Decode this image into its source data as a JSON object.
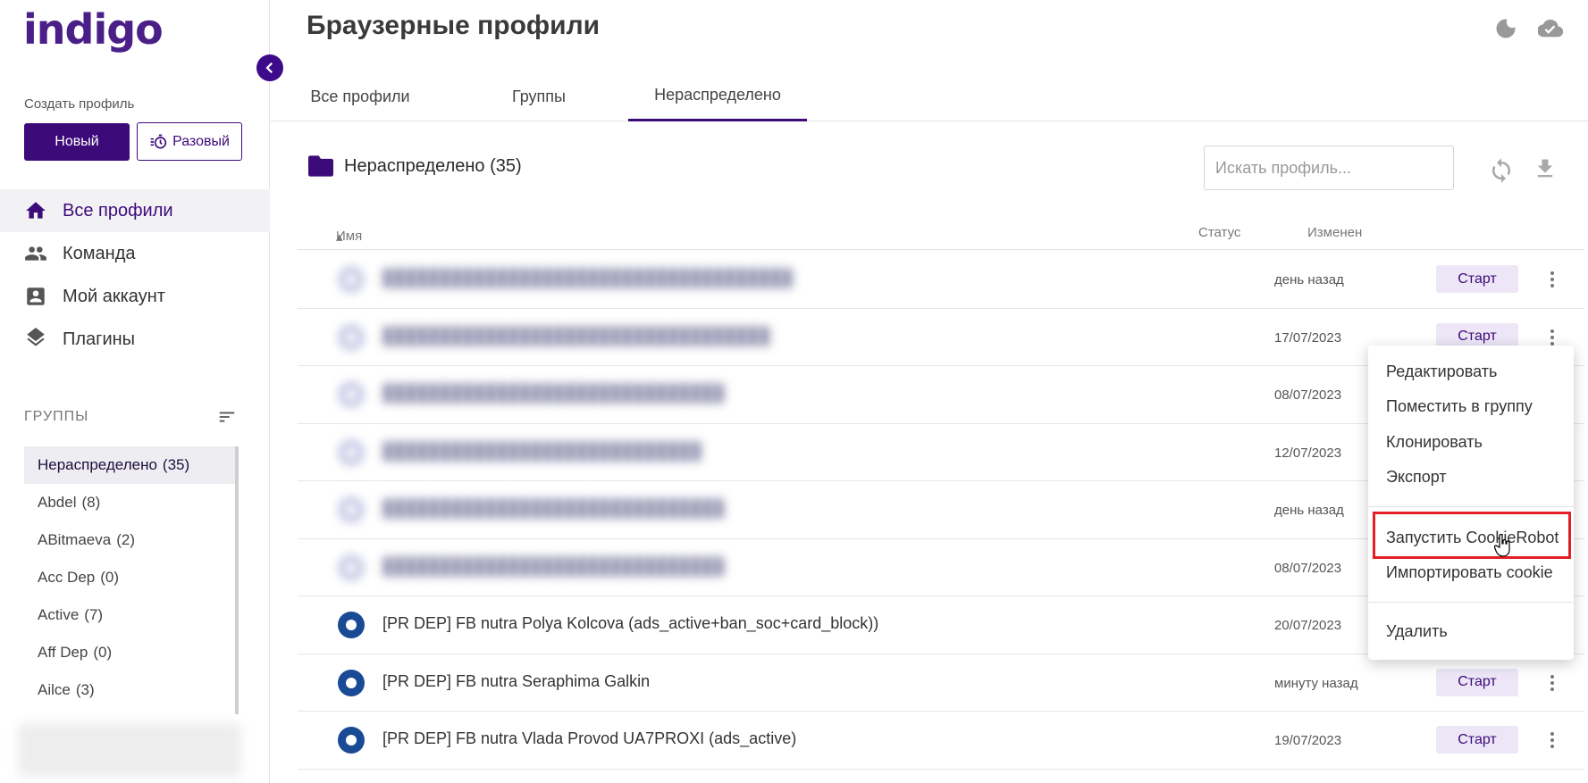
{
  "app": {
    "logo": "indigo",
    "page_title": "Браузерные профили"
  },
  "sidebar": {
    "create_label": "Создать профиль",
    "new_button": "Новый",
    "once_button": "Разовый",
    "nav": [
      {
        "label": "Все профили",
        "icon": "home-icon"
      },
      {
        "label": "Команда",
        "icon": "team-icon"
      },
      {
        "label": "Мой аккаунт",
        "icon": "account-icon"
      },
      {
        "label": "Плагины",
        "icon": "layers-icon"
      }
    ],
    "groups_heading": "ГРУППЫ",
    "groups": [
      {
        "name": "Нераспределено",
        "count": "(35)"
      },
      {
        "name": "Abdel",
        "count": "(8)"
      },
      {
        "name": "ABitmaeva",
        "count": "(2)"
      },
      {
        "name": "Acc Dep",
        "count": "(0)"
      },
      {
        "name": "Active",
        "count": "(7)"
      },
      {
        "name": "Aff Dep",
        "count": "(0)"
      },
      {
        "name": "Ailce",
        "count": "(3)"
      }
    ]
  },
  "tabs": [
    "Все профили",
    "Группы",
    "Нераспределено"
  ],
  "section": {
    "title": "Нераспределено (35)",
    "search_placeholder": "Искать профиль..."
  },
  "table": {
    "headers": {
      "name": "Имя",
      "status": "Статус",
      "changed": "Изменен"
    },
    "start_label": "Старт",
    "rows": [
      {
        "name": "",
        "changed": "день назад",
        "blurred": true
      },
      {
        "name": "",
        "changed": "17/07/2023",
        "blurred": true
      },
      {
        "name": "",
        "changed": "08/07/2023",
        "blurred": true
      },
      {
        "name": "",
        "changed": "12/07/2023",
        "blurred": true
      },
      {
        "name": "",
        "changed": "день назад",
        "blurred": true
      },
      {
        "name": "",
        "changed": "08/07/2023",
        "blurred": true
      },
      {
        "name": "[PR DEP] FB nutra Polya Kolcova (ads_active+ban_soc+card_block))",
        "changed": "20/07/2023",
        "blurred": false
      },
      {
        "name": "[PR DEP] FB nutra Seraphima Galkin",
        "changed": "минуту назад",
        "blurred": false
      },
      {
        "name": "[PR DEP] FB nutra Vlada Provod UA7PROXI (ads_active)",
        "changed": "19/07/2023",
        "blurred": false
      }
    ]
  },
  "context_menu": {
    "edit": "Редактировать",
    "move_to_group": "Поместить в группу",
    "clone": "Клонировать",
    "export": "Экспорт",
    "run_cookierobot": "Запустить CookieRobot",
    "import_cookie": "Импортировать cookie",
    "delete": "Удалить"
  },
  "colors": {
    "brand": "#3d0a7a",
    "highlight": "#e41e26",
    "start_bg": "#ece6f6"
  }
}
